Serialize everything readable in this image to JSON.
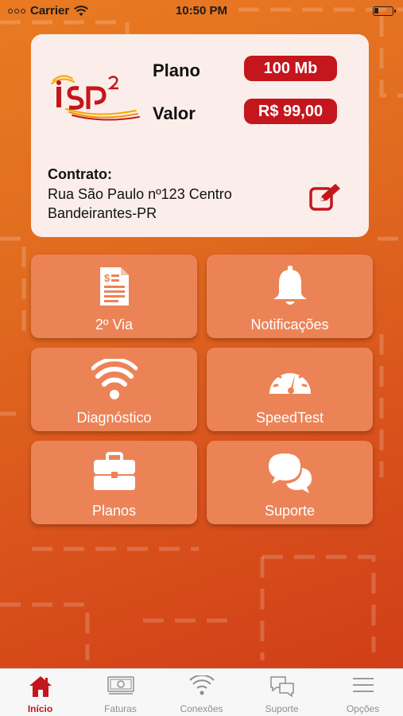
{
  "status_bar": {
    "carrier": "Carrier",
    "time": "10:50 PM"
  },
  "account_card": {
    "logo_text": "ISP2",
    "plan_label": "Plano",
    "plan_value": "100 Mb",
    "price_label": "Valor",
    "price_value": "R$ 99,00",
    "contract_title": "Contrato:",
    "contract_address_line1": "Rua São Paulo nº123 Centro",
    "contract_address_line2": "Bandeirantes-PR",
    "edit_icon": "edit-icon"
  },
  "menu_tiles": [
    {
      "label": "2º Via",
      "icon": "invoice-document-icon"
    },
    {
      "label": "Notificações",
      "icon": "bell-icon"
    },
    {
      "label": "Diagnóstico",
      "icon": "wifi-icon"
    },
    {
      "label": "SpeedTest",
      "icon": "speedometer-icon"
    },
    {
      "label": "Planos",
      "icon": "briefcase-icon"
    },
    {
      "label": "Suporte",
      "icon": "chat-bubbles-icon"
    }
  ],
  "tab_bar": {
    "items": [
      {
        "label": "Início",
        "icon": "home-icon",
        "active": true
      },
      {
        "label": "Faturas",
        "icon": "money-bill-icon",
        "active": false
      },
      {
        "label": "Conexões",
        "icon": "wifi-icon",
        "active": false
      },
      {
        "label": "Suporte",
        "icon": "chat-bubbles-icon",
        "active": false
      },
      {
        "label": "Opções",
        "icon": "menu-icon",
        "active": false
      }
    ]
  },
  "colors": {
    "brand_red": "#c4161c",
    "tile_background": "#ec8357",
    "background_start": "#ea7a22",
    "background_end": "#cf3a16",
    "card_background": "#fbeeea"
  }
}
